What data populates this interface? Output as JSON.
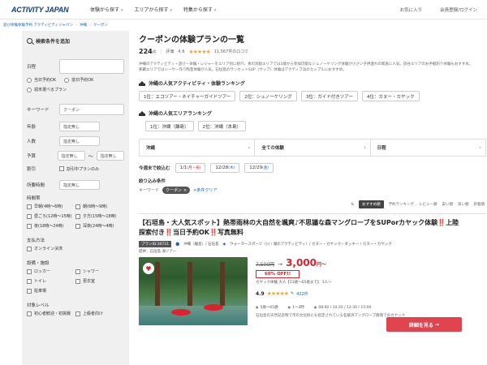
{
  "header": {
    "logo": "ACTIVITY JAPAN",
    "nav": [
      {
        "label": "体験から探す"
      },
      {
        "label": "エリアから探す"
      },
      {
        "label": "特集から探す"
      }
    ],
    "favorites": "お気に入り",
    "login": "会員登録/ログイン"
  },
  "breadcrumb": [
    "遊び体験体験予約 アクティビティジャパン",
    "沖縄",
    "クーポン"
  ],
  "sidebar": {
    "title": "検索条件を追加",
    "date_label": "日程",
    "date_options": [
      "当日予約OK",
      "前日予約OK",
      "週末選べるプラン"
    ],
    "keyword_label": "キーワード",
    "keyword_value": "クーポン",
    "age_label": "年齢",
    "age_value": "指定無し",
    "people_label": "人数",
    "people_value": "指定無し",
    "budget_label": "予算",
    "budget_min": "指定無し",
    "budget_sep": "〜",
    "budget_max": "指定無し",
    "discount_label": "割引",
    "discount_option": "割引中プランのみ",
    "duration_label": "所要時間",
    "duration_value": "指定無し",
    "time_label": "時間帯",
    "time_options": [
      "早朝(4時〜6時)",
      "朝(6時〜9時)",
      "昼ごろ(12時〜15時)",
      "夕方(15時〜18時)",
      "夜(18時〜24時)",
      "深夜(24時〜4時)"
    ],
    "payment_label": "支払方法",
    "payment_option": "オンライン決済",
    "facility_label": "設備・施設",
    "facility_options": [
      "ロッカー",
      "シャワー",
      "トイレ",
      "更衣室",
      "駐車場"
    ],
    "level_label": "対象レベル",
    "level_options": [
      "初心者歓迎・初挑戦",
      "上級者向け"
    ]
  },
  "main": {
    "title": "クーポンの体験プランの一覧",
    "count": "224",
    "count_unit": "件",
    "rating_label": "評価",
    "rating": "4.8",
    "stars": "★★★★★",
    "reviews": "11,567件の口コミ",
    "description": "沖縄のアクティビティ・遊び・体験・レジャーをエリア別に紹介。青の洞窟エリアでは3歳から参加可能なシュノーケリング体験が小さい子供連れの家族に人気。読谷エリアのお手軽釣り体験もおすすめ。那覇エリアではシーサー作り陶芸体験が人気。石垣島のサンセットSUP（サップ）体験はアクティブ派のカップルにおすすめ。",
    "ranking1_title": "沖縄の人気アクティビティ・体験ランキング",
    "ranking1": [
      "1位：エコツアー・ネイチャーガイドツアー",
      "2位：シュノーケリング",
      "3位：ガイド付きツアー",
      "4位：カヌー・カヤック"
    ],
    "ranking2_title": "沖縄の人気エリアランキング",
    "ranking2": [
      "1位：沖縄（離島）",
      "2位：沖縄（本島）"
    ],
    "selectors": [
      "沖縄",
      "全ての体験",
      "日程"
    ],
    "week_title": "今週末で絞込む",
    "week_dates": [
      {
        "date": "1/1",
        "day": "(月・祝)"
      },
      {
        "date": "12/28",
        "day": "(木)"
      },
      {
        "date": "12/29",
        "day": "(金)"
      }
    ],
    "refine_title": "絞り込み条件",
    "keyword_label": "キーワード",
    "keyword_chip": "クーポン",
    "clear_all": "×条件クリア",
    "sort": [
      "おすすめ順",
      "予約ランキング",
      "レビュー順",
      "安い順",
      "高い順",
      "新着順"
    ],
    "plan": {
      "title_a": "【石垣島・大人気スポット】熱帯雨林の大自然を颯爽♪不思議な森マングローブをSUPorカヤック体験",
      "mark1": "‼️",
      "title_b": "上陸探索付き",
      "mark2": "‼️",
      "title_c": "当日予約OK",
      "mark3": "‼️",
      "title_d": "写真無料",
      "plan_id": "プランID:30721",
      "location": "沖縄（離島）/ 石垣島",
      "category": "ウォータースポーツ（川・湖のアクティビティ）/ カヌー・カヤック・ダッキー / カヌー・カヤック",
      "provider": "提供：石垣島 海ツアー",
      "old_price": "7,500円",
      "arrow": "→",
      "new_price": "3,000",
      "yen": "円〜",
      "off": "60% OFF!!",
      "unit": "カヤック体験 大人【13歳〜65歳まで】 1人〜",
      "score": "4.9",
      "stars": "★★★★★",
      "review_count": "422件",
      "age": "5歳〜65歳",
      "time": "1〜3時",
      "schedule": "08:00 / 10:30 / 12:30 / 15:00",
      "button": "詳細を見る",
      "footnote": "石垣島の天然記念物で市の文化財にも指定されている名蔵湾マングローブ群落でのカヤック"
    }
  }
}
